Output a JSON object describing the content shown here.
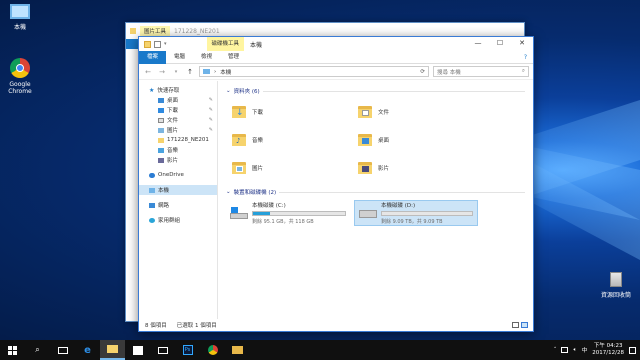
{
  "desktop": {
    "icons": [
      {
        "name": "this-pc",
        "label": "本機"
      },
      {
        "name": "google-chrome",
        "label": "Google\nChrome"
      },
      {
        "name": "recycle-bin",
        "label": "資源回收筒"
      }
    ]
  },
  "back_window": {
    "ctx_tab": "圖片工具",
    "title": "171228_NE201"
  },
  "window": {
    "ctx_tab": "磁碟機工具",
    "title": "本機",
    "controls": {
      "min": "—",
      "max": "☐",
      "close": "✕"
    },
    "tabs": [
      "檔案",
      "電腦",
      "檢視",
      "管理"
    ],
    "help": "?",
    "address": {
      "path": "本機",
      "separator": "›"
    },
    "search": {
      "placeholder": "搜尋 本機"
    },
    "nav_pane": [
      {
        "label": "快速存取",
        "level": 0
      },
      {
        "label": "桌面",
        "level": 1,
        "pinned": true
      },
      {
        "label": "下載",
        "level": 1,
        "pinned": true
      },
      {
        "label": "文件",
        "level": 1,
        "pinned": true
      },
      {
        "label": "圖片",
        "level": 1,
        "pinned": true
      },
      {
        "label": "171228_NE201",
        "level": 1
      },
      {
        "label": "音樂",
        "level": 1
      },
      {
        "label": "影片",
        "level": 1
      },
      {
        "label": "OneDrive",
        "level": 0
      },
      {
        "label": "本機",
        "level": 0,
        "selected": true
      },
      {
        "label": "網路",
        "level": 0
      },
      {
        "label": "家用群組",
        "level": 0
      }
    ],
    "folders_header": "資料夾 (6)",
    "folders": [
      "下載",
      "文件",
      "音樂",
      "桌面",
      "圖片",
      "影片"
    ],
    "drives_header": "裝置和磁碟機 (2)",
    "drives": [
      {
        "name": "本機磁碟 (C:)",
        "free": "剩餘 95.1 GB，共 118 GB",
        "used_fraction": 0.19
      },
      {
        "name": "本機磁碟 (D:)",
        "free": "剩餘 9.09 TB，共 9.09 TB",
        "used_fraction": 0.0,
        "selected": true
      }
    ],
    "status": {
      "items": "8 個項目",
      "selected": "已選取 1 個項目"
    }
  },
  "taskbar": {
    "clock_period": "下午 04:23",
    "clock_date": "2017/12/28",
    "ime": "中"
  },
  "colors": {
    "accent": "#1979ca",
    "selection": "#cce4f7",
    "drive_bar": "#26a0da",
    "folder": "#f6d36d"
  }
}
